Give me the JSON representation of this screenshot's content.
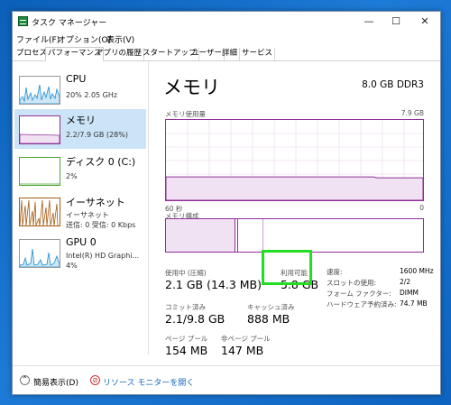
{
  "window": {
    "title": "タスク マネージャー",
    "minimize": "—",
    "maximize": "☐",
    "close": "✕"
  },
  "menu": [
    "ファイル(F)",
    "オプション(O)",
    "表示(V)"
  ],
  "tabs": [
    "プロセス",
    "パフォーマンス",
    "アプリの履歴",
    "スタートアップ",
    "ユーザー",
    "詳細",
    "サービス"
  ],
  "active_tab": "パフォーマンス",
  "sidebar": [
    {
      "name": "CPU",
      "line1": "20%  2.05 GHz",
      "line2": ""
    },
    {
      "name": "メモリ",
      "line1": "2.2/7.9 GB (28%)",
      "line2": ""
    },
    {
      "name": "ディスク 0 (C:)",
      "line1": "2%",
      "line2": ""
    },
    {
      "name": "イーサネット",
      "line1": "イーサネット",
      "line2": "送信: 0 受信: 0 Kbps"
    },
    {
      "name": "GPU 0",
      "line1": "Intel(R) HD Graphi...",
      "line2": "4%"
    }
  ],
  "detail": {
    "title": "メモリ",
    "spec": "8.0 GB DDR3",
    "usage_label": "メモリ使用量",
    "usage_max": "7.9 GB",
    "time_label": "60 秒",
    "time_end": "0",
    "composition_label": "メモリ構成",
    "usage_fraction": 0.28
  },
  "stats": {
    "in_use_label": "使用中 (圧縮)",
    "in_use_value": "2.1 GB (14.3 MB)",
    "available_label": "利用可能",
    "available_value": "5.8 GB",
    "committed_label": "コミット済み",
    "committed_value": "2.1/9.8 GB",
    "cached_label": "キャッシュ済み",
    "cached_value": "888 MB",
    "paged_label": "ページ プール",
    "paged_value": "154 MB",
    "nonpaged_label": "非ページ プール",
    "nonpaged_value": "147 MB"
  },
  "hardware": [
    {
      "key": "速度:",
      "value": "1600 MHz"
    },
    {
      "key": "スロットの使用:",
      "value": "2/2"
    },
    {
      "key": "フォーム ファクター:",
      "value": "DIMM"
    },
    {
      "key": "ハードウェア予約済み:",
      "value": "74.7 MB"
    }
  ],
  "footer": {
    "fewer_details": "簡易表示(D)",
    "resource_monitor": "リソース モニターを開く"
  },
  "colors": {
    "cpu": "#1a8ed1",
    "memory": "#8f2f97",
    "disk": "#4da633",
    "ethernet": "#a75a12",
    "gpu": "#1a8ed1",
    "highlight": "#22dd22"
  }
}
